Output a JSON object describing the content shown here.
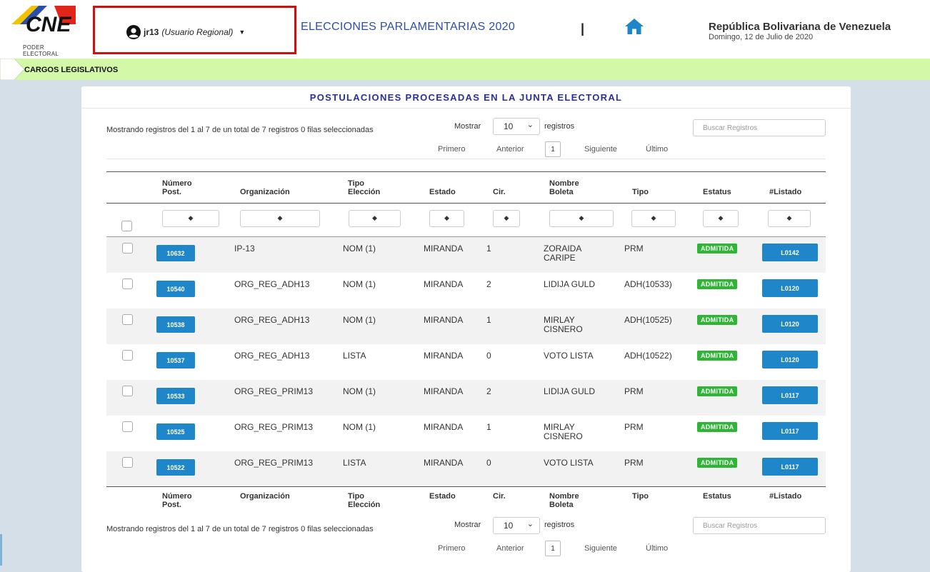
{
  "header": {
    "logo_text": "PODER ELECTORAL",
    "user_name": "jr13",
    "user_role": "(Usuario Regional)",
    "app_title": "ELECCIONES PARLAMENTARIAS 2020",
    "separator": "|",
    "country": "República Bolivariana de Venezuela",
    "date": "Domingo, 12 de Julio de 2020"
  },
  "breadcrumb": {
    "label": "CARGOS LEGISLATIVOS"
  },
  "panel": {
    "title": "POSTULACIONES PROCESADAS EN LA JUNTA ELECTORAL",
    "info": "Mostrando registros del 1 al 7 de un total de 7 registros   0 filas seleccionadas",
    "mostrar": "Mostrar",
    "page_length": "10",
    "registros": "registros",
    "search_placeholder": "Buscar Registros",
    "pager": {
      "first": "Primero",
      "prev": "Anterior",
      "current": "1",
      "next": "Siguiente",
      "last": "Último"
    }
  },
  "table": {
    "headers": {
      "numero": "Número Post.",
      "organizacion": "Organización",
      "tipo_eleccion": "Tipo Elección",
      "estado": "Estado",
      "cir": "Cir.",
      "nombre_boleta": "Nombre Boleta",
      "tipo": "Tipo",
      "estatus": "Estatus",
      "listado": "#Listado"
    },
    "rows": [
      {
        "numero": "10632",
        "organizacion": "IP-13",
        "tipo_eleccion": "NOM (1)",
        "estado": "MIRANDA",
        "cir": "1",
        "nombre_boleta": "ZORAIDA CARIPE",
        "tipo": "PRM",
        "estatus": "ADMITIDA",
        "listado": "L0142"
      },
      {
        "numero": "10540",
        "organizacion": "ORG_REG_ADH13",
        "tipo_eleccion": "NOM (1)",
        "estado": "MIRANDA",
        "cir": "2",
        "nombre_boleta": "LIDIJA GULD",
        "tipo": "ADH(10533)",
        "estatus": "ADMITIDA",
        "listado": "L0120"
      },
      {
        "numero": "10538",
        "organizacion": "ORG_REG_ADH13",
        "tipo_eleccion": "NOM (1)",
        "estado": "MIRANDA",
        "cir": "1",
        "nombre_boleta": "MIRLAY CISNERO",
        "tipo": "ADH(10525)",
        "estatus": "ADMITIDA",
        "listado": "L0120"
      },
      {
        "numero": "10537",
        "organizacion": "ORG_REG_ADH13",
        "tipo_eleccion": "LISTA",
        "estado": "MIRANDA",
        "cir": "0",
        "nombre_boleta": "VOTO LISTA",
        "tipo": "ADH(10522)",
        "estatus": "ADMITIDA",
        "listado": "L0120"
      },
      {
        "numero": "10533",
        "organizacion": "ORG_REG_PRIM13",
        "tipo_eleccion": "NOM (1)",
        "estado": "MIRANDA",
        "cir": "2",
        "nombre_boleta": "LIDIJA GULD",
        "tipo": "PRM",
        "estatus": "ADMITIDA",
        "listado": "L0117"
      },
      {
        "numero": "10525",
        "organizacion": "ORG_REG_PRIM13",
        "tipo_eleccion": "NOM (1)",
        "estado": "MIRANDA",
        "cir": "1",
        "nombre_boleta": "MIRLAY CISNERO",
        "tipo": "PRM",
        "estatus": "ADMITIDA",
        "listado": "L0117"
      },
      {
        "numero": "10522",
        "organizacion": "ORG_REG_PRIM13",
        "tipo_eleccion": "LISTA",
        "estado": "MIRANDA",
        "cir": "0",
        "nombre_boleta": "VOTO LISTA",
        "tipo": "PRM",
        "estatus": "ADMITIDA",
        "listado": "L0117"
      }
    ]
  },
  "colors": {
    "brand_blue": "#2a4fa8",
    "button_blue": "#1f87c9",
    "status_green": "#2eb536",
    "breadcrumb_green": "#d3f8a8",
    "highlight_red": "#cc1111"
  },
  "icons": {
    "user": "user-circle-icon",
    "home": "home-icon",
    "sort": "sort-icon",
    "caret": "caret-down-icon"
  }
}
